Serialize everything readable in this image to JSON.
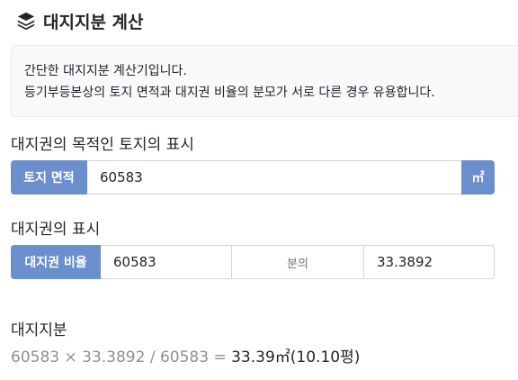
{
  "header": {
    "title": "대지지분 계산",
    "icon": "layers-icon"
  },
  "info": {
    "line1": "간단한 대지지분 계산기입니다.",
    "line2": "등기부등본상의 토지 면적과 대지권 비율의 분모가 서로 다른 경우 유용합니다."
  },
  "land_section": {
    "title": "대지권의 목적인 토지의 표시",
    "area_label": "토지 면적",
    "area_value": "60583",
    "unit": "㎡"
  },
  "ratio_section": {
    "title": "대지권의 표시",
    "ratio_label": "대지권 비율",
    "denominator": "60583",
    "between_label": "분의",
    "numerator": "33.3892"
  },
  "result": {
    "title": "대지지분",
    "formula": "60583 × 33.3892 / 60583 = ",
    "answer": "33.39㎡(10.10평)"
  },
  "colors": {
    "accent": "#6a8fcc",
    "muted_text": "#8a9099",
    "info_bg": "#f8f9fa"
  }
}
